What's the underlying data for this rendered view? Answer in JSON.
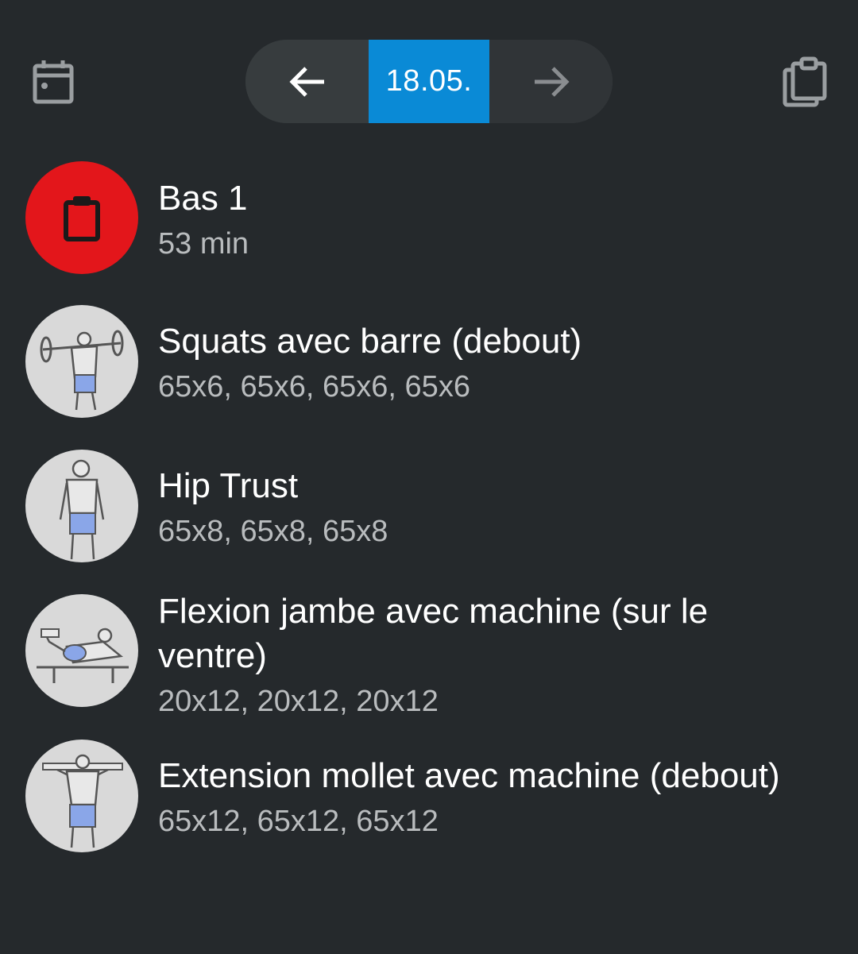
{
  "header": {
    "calendar_icon": "calendar-icon",
    "prev_icon": "arrow-left-icon",
    "date": "18.05.",
    "next_icon": "arrow-right-icon",
    "copy_icon": "copy-clipboard-icon",
    "accent_color": "#0a8ad6"
  },
  "workout": {
    "title": "Bas 1",
    "duration": "53 min",
    "icon": "clipboard-icon",
    "color": "#e3161b"
  },
  "exercises": [
    {
      "name": "Squats avec barre (debout)",
      "sets": "65x6, 65x6, 65x6, 65x6",
      "image": "barbell-squat-figure"
    },
    {
      "name": "Hip Trust",
      "sets": "65x8, 65x8, 65x8",
      "image": "hip-thrust-figure"
    },
    {
      "name": "Flexion jambe avec machine (sur le ventre)",
      "sets": "20x12, 20x12, 20x12",
      "image": "lying-leg-curl-figure"
    },
    {
      "name": "Extension mollet avec machine (debout)",
      "sets": "65x12, 65x12, 65x12",
      "image": "calf-raise-figure"
    }
  ]
}
